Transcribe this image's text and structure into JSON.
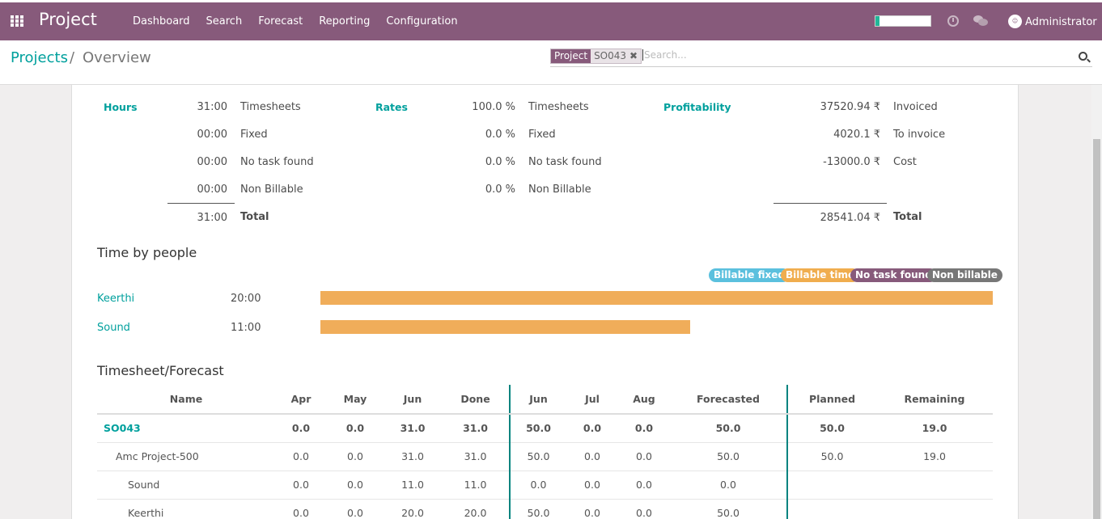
{
  "app": {
    "title": "Project",
    "menu": [
      "Dashboard",
      "Search",
      "Forecast",
      "Reporting",
      "Configuration"
    ],
    "user": "Administrator",
    "progress": 0.08
  },
  "breadcrumb": {
    "parent": "Projects",
    "separator": "/",
    "current": "Overview"
  },
  "search": {
    "facet_category": "Project",
    "facet_value": "SO043",
    "placeholder": "Search..."
  },
  "summary": {
    "hours": {
      "title": "Hours",
      "rows": [
        {
          "value": "31:00",
          "label": "Timesheets"
        },
        {
          "value": "00:00",
          "label": "Fixed"
        },
        {
          "value": "00:00",
          "label": "No task found"
        },
        {
          "value": "00:00",
          "label": "Non Billable"
        }
      ],
      "total_value": "31:00",
      "total_label": "Total"
    },
    "rates": {
      "title": "Rates",
      "rows": [
        {
          "value": "100.0 %",
          "label": "Timesheets"
        },
        {
          "value": "0.0 %",
          "label": "Fixed"
        },
        {
          "value": "0.0 %",
          "label": "No task found"
        },
        {
          "value": "0.0 %",
          "label": "Non Billable"
        }
      ]
    },
    "profitability": {
      "title": "Profitability",
      "rows": [
        {
          "value": "37520.94 ₹",
          "label": "Invoiced"
        },
        {
          "value": "4020.1 ₹",
          "label": "To invoice"
        },
        {
          "value": "-13000.0 ₹",
          "label": "Cost"
        }
      ],
      "total_value": "28541.04 ₹",
      "total_label": "Total"
    }
  },
  "time_by_people": {
    "title": "Time by people",
    "legend": [
      {
        "label": "Billable fixed",
        "color": "#5bc0de"
      },
      {
        "label": "Billable time",
        "color": "#f0ad4e"
      },
      {
        "label": "No task found",
        "color": "#875a7b"
      },
      {
        "label": "Non billable",
        "color": "#777777"
      }
    ],
    "people": [
      {
        "name": "Keerthi",
        "hours": "20:00",
        "hours_value": 20
      },
      {
        "name": "Sound",
        "hours": "11:00",
        "hours_value": 11
      }
    ],
    "max_hours": 20,
    "bar_color": "#f0ad5a"
  },
  "timesheet_forecast": {
    "title": "Timesheet/Forecast",
    "columns": [
      "Name",
      "Apr",
      "May",
      "Jun",
      "Done",
      "Jun",
      "Jul",
      "Aug",
      "Forecasted",
      "Planned",
      "Remaining"
    ],
    "rows": [
      {
        "name": "SO043",
        "cells": [
          "0.0",
          "0.0",
          "31.0",
          "31.0",
          "50.0",
          "0.0",
          "0.0",
          "50.0",
          "50.0",
          "19.0"
        ]
      },
      {
        "name": "Amc Project-500",
        "cells": [
          "0.0",
          "0.0",
          "31.0",
          "31.0",
          "50.0",
          "0.0",
          "0.0",
          "50.0",
          "50.0",
          "19.0"
        ]
      },
      {
        "name": "Sound",
        "cells": [
          "0.0",
          "0.0",
          "11.0",
          "11.0",
          "0.0",
          "0.0",
          "0.0",
          "0.0",
          "",
          ""
        ]
      },
      {
        "name": "Keerthi",
        "cells": [
          "0.0",
          "0.0",
          "20.0",
          "20.0",
          "50.0",
          "0.0",
          "0.0",
          "50.0",
          "",
          ""
        ]
      }
    ]
  }
}
